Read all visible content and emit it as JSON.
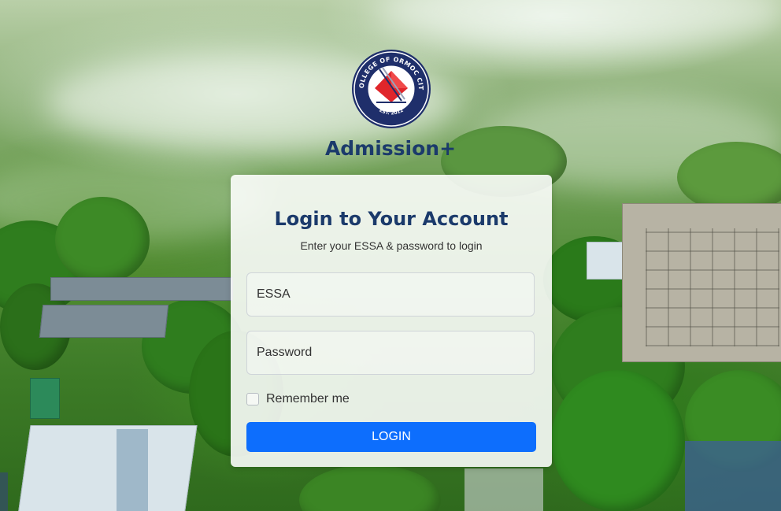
{
  "brand": {
    "title": "Admission+",
    "logo_top_text": "ACLC COLLEGE OF ORMOC CITY, INC.",
    "logo_bottom_text": "EST. 2012",
    "logo_icon": "aclc-college-seal"
  },
  "login_card": {
    "title": "Login to Your Account",
    "subtitle": "Enter your ESSA & password to login",
    "essa_placeholder": "ESSA",
    "password_placeholder": "Password",
    "remember_label": "Remember me",
    "remember_checked": false,
    "login_button_label": "LOGIN"
  },
  "colors": {
    "brand_navy": "#1b3a6b",
    "button_blue": "#0d6efd",
    "seal_red": "#e0262b"
  }
}
